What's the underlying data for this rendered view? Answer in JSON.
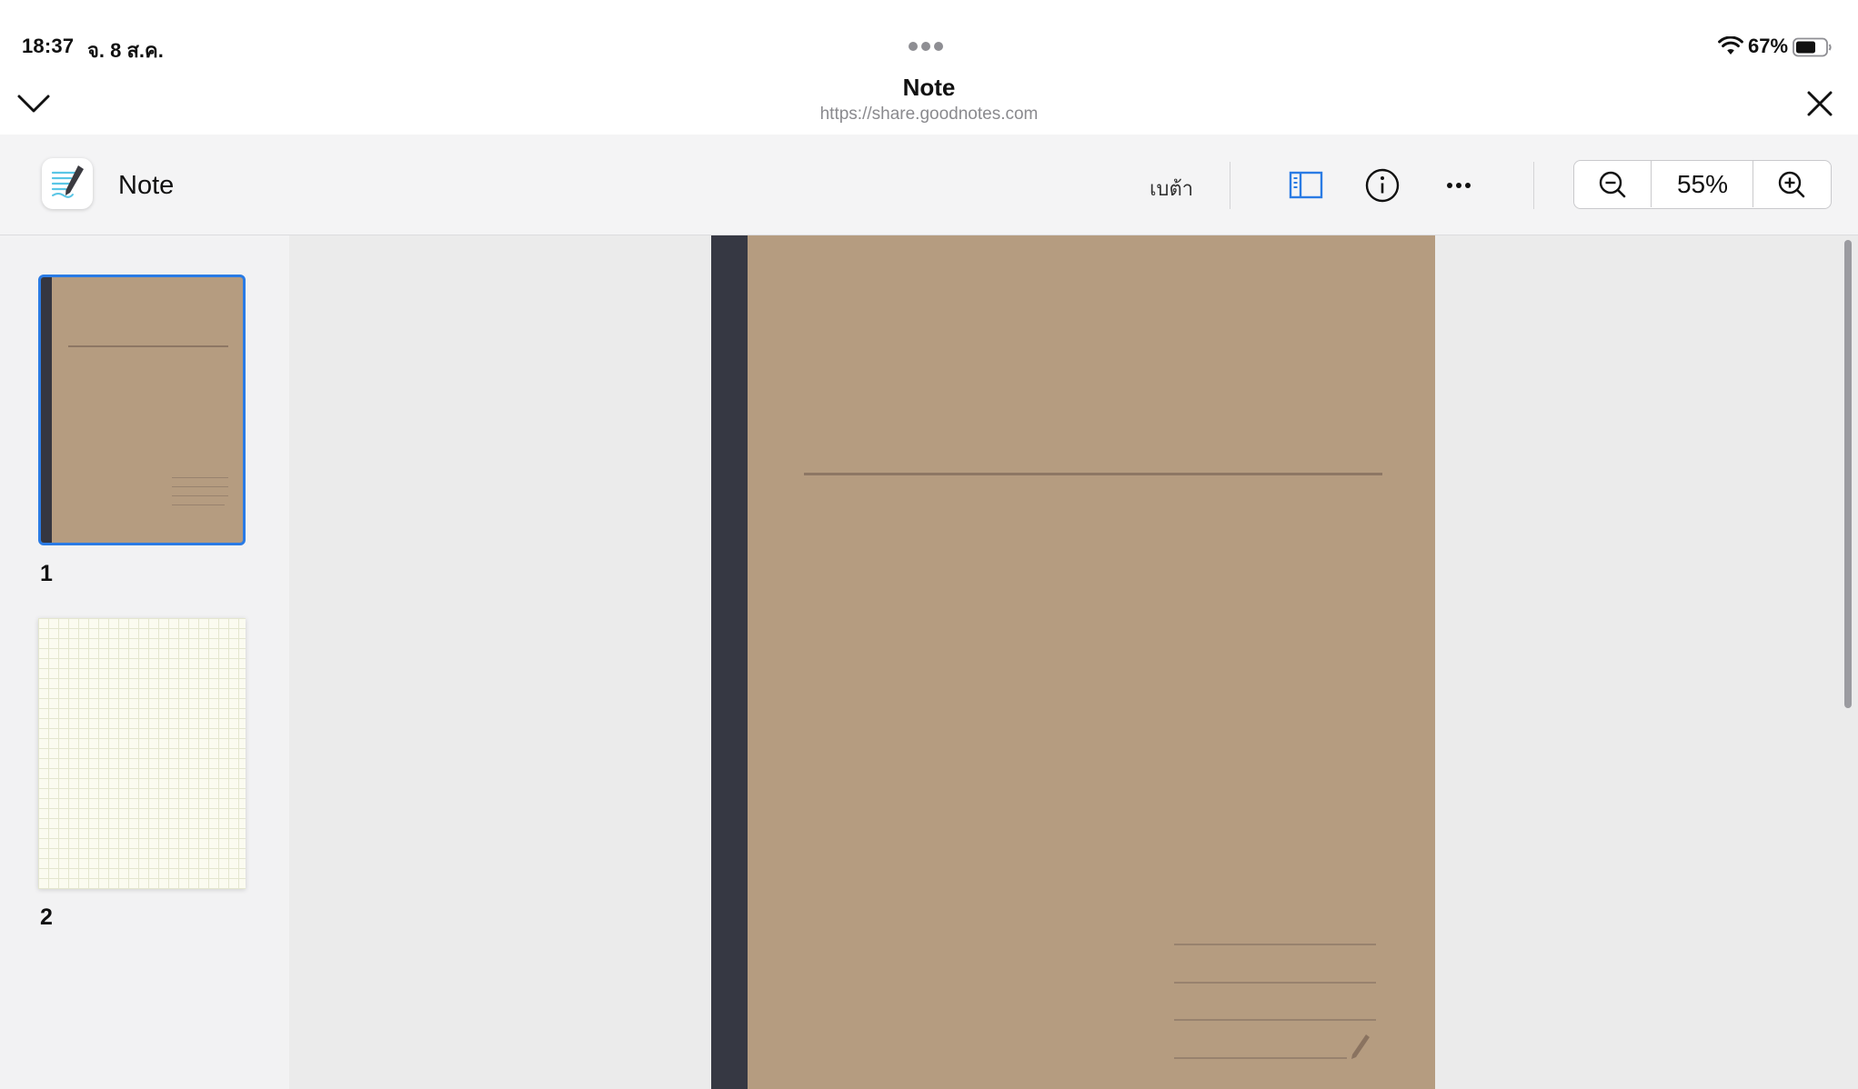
{
  "status_bar": {
    "time": "18:37",
    "date": "จ. 8 ส.ค.",
    "battery_percent": "67%",
    "battery_level": 0.67,
    "icons": [
      "multitask-dots-icon",
      "wifi-icon",
      "battery-icon"
    ]
  },
  "sheet": {
    "title": "Note",
    "url": "https://share.goodnotes.com",
    "icons": [
      "chevron-down-icon",
      "close-icon"
    ]
  },
  "toolbar": {
    "app_name": "Note",
    "beta_label": "เบต้า",
    "zoom_level": "55%",
    "icons": [
      "goodnotes-app-icon",
      "sidebar-toggle-icon",
      "info-icon",
      "more-icon",
      "zoom-out-icon",
      "zoom-in-icon"
    ],
    "accent_color": "#2a7be4"
  },
  "sidebar": {
    "pages": [
      {
        "label": "1",
        "template": "brown-cover",
        "selected": true
      },
      {
        "label": "2",
        "template": "grid-paper",
        "selected": false
      }
    ]
  },
  "document": {
    "cover_color": "#b59c80",
    "spine_color": "#363843"
  }
}
